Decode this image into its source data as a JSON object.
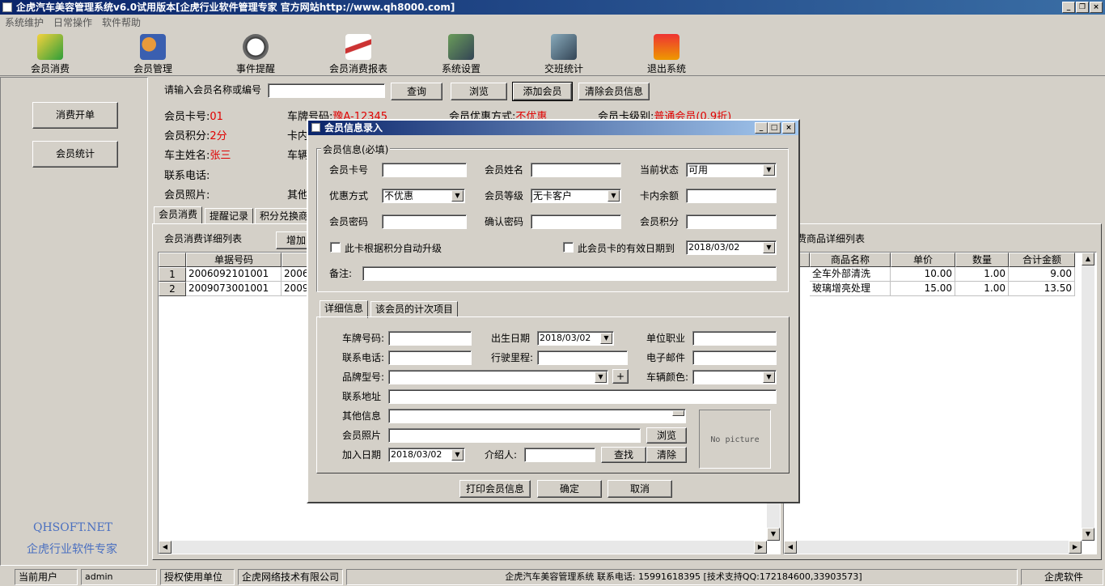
{
  "app": {
    "title": "企虎汽车美容管理系统v6.0试用版本[企虎行业软件管理专家 官方网站http://www.qh8000.com]"
  },
  "menu": [
    "系统维护",
    "日常操作",
    "软件帮助"
  ],
  "toolbar": [
    "会员消费",
    "会员管理",
    "事件提醒",
    "会员消费报表",
    "系统设置",
    "交班统计",
    "退出系统"
  ],
  "left_panel": {
    "buttons": [
      "消费开单",
      "会员统计"
    ],
    "brand_line1": "QHSOFT.NET",
    "brand_line2": "企虎行业软件专家"
  },
  "search": {
    "label": "请输入会员名称或编号",
    "value": "",
    "buttons": [
      "查询",
      "浏览",
      "添加会员",
      "清除会员信息"
    ]
  },
  "member_info": {
    "card_no_label": "会员卡号:",
    "card_no": "01",
    "points_label": "会员积分:",
    "points": "2分",
    "owner_label": "车主姓名:",
    "owner": "张三",
    "phone_label": "联系电话:",
    "photo_label": "会员照片:",
    "plate_label": "车牌号码:",
    "plate": "豫A-12345",
    "inner_label": "卡内",
    "car_label": "车辆",
    "other_label": "其他",
    "discount_label": "会员优惠方式:",
    "discount": "不优惠",
    "level_label": "会员卡级别:",
    "level": "普通会员(0.9折)"
  },
  "tabs": [
    "会员消费",
    "提醒记录",
    "积分兑换商"
  ],
  "left_list": {
    "title": "会员消费详细列表",
    "add_button": "增加",
    "columns": [
      "单据号码",
      ""
    ],
    "rows": [
      {
        "idx": "1",
        "no": "2006092101001",
        "col2": "2006"
      },
      {
        "idx": "2",
        "no": "2009073001001",
        "col2": "2009"
      }
    ]
  },
  "right_list": {
    "title": "费商品详细列表",
    "columns": [
      "商品名称",
      "单价",
      "数量",
      "合计金额"
    ],
    "rows": [
      {
        "name": "全车外部清洗",
        "price": "10.00",
        "qty": "1.00",
        "total": "9.00"
      },
      {
        "name": "玻璃增亮处理",
        "price": "15.00",
        "qty": "1.00",
        "total": "13.50"
      }
    ]
  },
  "dialog": {
    "title": "会员信息录入",
    "group_title": "会员信息(必填)",
    "fields": {
      "card_no": "会员卡号",
      "name": "会员姓名",
      "status": "当前状态",
      "status_value": "可用",
      "discount": "优惠方式",
      "discount_value": "不优惠",
      "level": "会员等级",
      "level_value": "无卡客户",
      "balance": "卡内余额",
      "password": "会员密码",
      "confirm": "确认密码",
      "points": "会员积分",
      "auto_upgrade": "此卡根据积分自动升级",
      "expiry": "此会员卡的有效日期到",
      "expiry_value": "2018/03/02",
      "remark": "备注:"
    },
    "tabs": [
      "详细信息",
      "该会员的计次项目"
    ],
    "detail": {
      "plate": "车牌号码:",
      "birthday": "出生日期",
      "birthday_value": "2018/03/02",
      "job": "单位职业",
      "phone": "联系电话:",
      "mileage": "行驶里程:",
      "email": "电子邮件",
      "brand": "品牌型号:",
      "plus": "+",
      "color": "车辆颜色:",
      "address": "联系地址",
      "other": "其他信息",
      "photo": "会员照片",
      "browse": "浏览",
      "join_date": "加入日期",
      "join_date_value": "2018/03/02",
      "referrer": "介绍人:",
      "find": "查找",
      "clear": "清除",
      "no_picture": "No picture"
    },
    "buttons": [
      "打印会员信息",
      "确定",
      "取消"
    ]
  },
  "status_bar": {
    "user_label": "当前用户",
    "user": "admin",
    "licensee_label": "授权使用单位",
    "licensee": "企虎网络技术有限公司",
    "info": "企虎汽车美容管理系统  联系电话: 15991618395 [技术支持QQ:172184600,33903573]",
    "brand": "企虎软件"
  }
}
